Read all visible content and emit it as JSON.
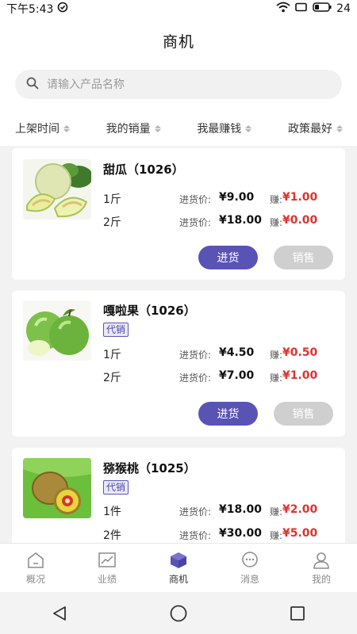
{
  "status_bar": {
    "time": "下午5:43",
    "battery": "24"
  },
  "header": {
    "title": "商机"
  },
  "search": {
    "placeholder": "请输入产品名称"
  },
  "sort": [
    "上架时间",
    "我的销量",
    "我最赚钱",
    "政策最好"
  ],
  "labels": {
    "purchase_price": "进货价:",
    "earn": "赚:",
    "buy_button": "进货",
    "sell_button": "销售"
  },
  "products": [
    {
      "name": "甜瓜（1026）",
      "image_icon": "melon-image",
      "tag": "",
      "rows": [
        {
          "unit": "1斤",
          "price": "¥9.00",
          "earn": "¥1.00"
        },
        {
          "unit": "2斤",
          "price": "¥18.00",
          "earn": "¥0.00"
        }
      ]
    },
    {
      "name": "嘎啦果（1026）",
      "image_icon": "green-apple-image",
      "tag": "代销",
      "rows": [
        {
          "unit": "1斤",
          "price": "¥4.50",
          "earn": "¥0.50"
        },
        {
          "unit": "2斤",
          "price": "¥7.00",
          "earn": "¥1.00"
        }
      ]
    },
    {
      "name": "猕猴桃（1025）",
      "image_icon": "kiwi-image",
      "tag": "代销",
      "rows": [
        {
          "unit": "1件",
          "price": "¥18.00",
          "earn": "¥2.00"
        },
        {
          "unit": "2件",
          "price": "¥30.00",
          "earn": "¥5.00"
        }
      ]
    }
  ],
  "tabs": [
    {
      "label": "概况",
      "icon": "home-icon"
    },
    {
      "label": "业绩",
      "icon": "chart-icon"
    },
    {
      "label": "商机",
      "icon": "cube-icon",
      "active": true
    },
    {
      "label": "消息",
      "icon": "message-icon"
    },
    {
      "label": "我的",
      "icon": "user-icon"
    }
  ],
  "colors": {
    "accent": "#5a53b6",
    "earn": "#e0322e",
    "sell_button": "#cfcfcf"
  }
}
